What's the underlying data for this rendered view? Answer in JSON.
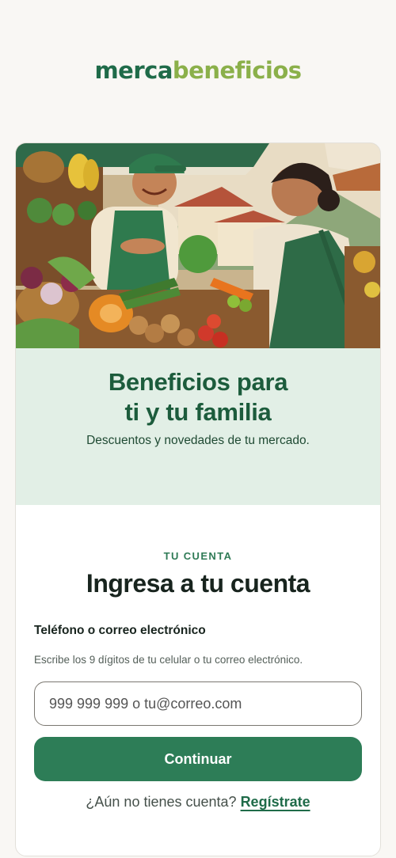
{
  "logo": {
    "part1": "merca",
    "part2": "beneficios"
  },
  "hero": {
    "image": "market-vendor-illustration"
  },
  "banner": {
    "title_line1": "Beneficios para",
    "title_line2": "ti y tu familia",
    "subtitle": "Descuentos y novedades de tu mercado."
  },
  "login": {
    "eyebrow": "TU CUENTA",
    "title": "Ingresa a tu cuenta",
    "field_label": "Teléfono o correo electrónico",
    "field_help": "Escribe los 9 dígitos de tu celular o tu correo electrónico.",
    "input_placeholder": "999 999 999 o tu@correo.com",
    "input_value": "",
    "continue_label": "Continuar",
    "signup_prompt": "¿Aún no tienes cuenta?",
    "signup_link": "Regístrate"
  },
  "colors": {
    "brand_dark": "#1f6b49",
    "brand_light": "#8bb04a",
    "button": "#2d7d57",
    "banner_bg": "#e2efe6"
  }
}
